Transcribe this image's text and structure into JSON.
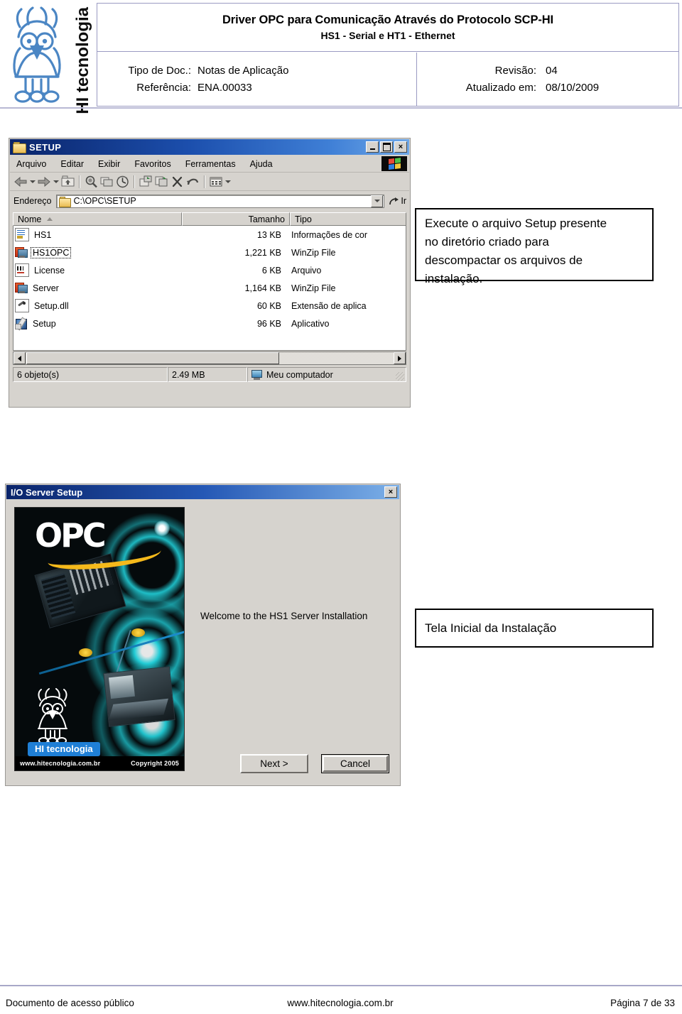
{
  "doc_header": {
    "logo_text": "HI tecnologia",
    "logo_icon": "owl-logo-icon",
    "title_line1": "Driver OPC para Comunicação Através do Protocolo SCP-HI",
    "title_line2": "HS1 - Serial e HT1 - Ethernet",
    "fields": {
      "doc_type_label": "Tipo de Doc.:",
      "doc_type_value": "Notas de Aplicação",
      "reference_label": "Referência:",
      "reference_value": "ENA.00033",
      "revision_label": "Revisão:",
      "revision_value": "04",
      "updated_label": "Atualizado em:",
      "updated_value": "08/10/2009"
    }
  },
  "explorer": {
    "title": "SETUP",
    "title_icon": "folder-icon",
    "window_buttons": {
      "minimize": "minimize-icon",
      "maximize": "maximize-icon",
      "close": "×"
    },
    "menu": [
      "Arquivo",
      "Editar",
      "Exibir",
      "Favoritos",
      "Ferramentas",
      "Ajuda"
    ],
    "brand_icon": "windows-flag-icon",
    "toolbar_icons": [
      "back-arrow-icon",
      "back-dropdown-icon",
      "forward-arrow-icon",
      "forward-dropdown-icon",
      "up-one-level-icon",
      "search-icon",
      "folders-icon",
      "history-icon",
      "move-to-icon",
      "copy-to-icon",
      "delete-icon",
      "undo-icon",
      "views-icon",
      "views-dropdown-icon"
    ],
    "address": {
      "label": "Endereço",
      "folder_icon": "folder-icon",
      "value": "C:\\OPC\\SETUP",
      "dropdown_icon": "chevron-down-icon",
      "go_icon": "go-arrow-icon",
      "go_label": "Ir"
    },
    "columns": [
      "Nome",
      "Tamanho",
      "Tipo"
    ],
    "sort_indicator": "sort-ascending-icon",
    "files": [
      {
        "name": "HS1",
        "size": "13 KB",
        "type": "Informações de cor",
        "icon": "inf-file-icon",
        "selected": false
      },
      {
        "name": "HS1OPC",
        "size": "1,221 KB",
        "type": "WinZip File",
        "icon": "winzip-file-icon",
        "selected": true
      },
      {
        "name": "License",
        "size": "6 KB",
        "type": "Arquivo",
        "icon": "generic-file-icon",
        "selected": false
      },
      {
        "name": "Server",
        "size": "1,164 KB",
        "type": "WinZip File",
        "icon": "winzip-file-icon",
        "selected": false
      },
      {
        "name": "Setup.dll",
        "size": "60 KB",
        "type": "Extensão de aplica",
        "icon": "dll-file-icon",
        "selected": false
      },
      {
        "name": "Setup",
        "size": "96 KB",
        "type": "Aplicativo",
        "icon": "application-icon",
        "selected": false
      }
    ],
    "status": {
      "objects": "6 objeto(s)",
      "total_size": "2.49 MB",
      "location": "Meu computador",
      "location_icon": "my-computer-icon"
    },
    "scrollbar": {
      "left_icon": "scroll-left-icon",
      "right_icon": "scroll-right-icon"
    }
  },
  "setup_dialog": {
    "title": "I/O Server Setup",
    "close_label": "×",
    "close_icon": "close-icon",
    "welcome_text": "Welcome to the HS1 Server Installation",
    "buttons": {
      "next": "Next >",
      "cancel": "Cancel"
    },
    "artwork": {
      "brand": "OPC",
      "badge": "HI tecnologia",
      "owl_icon": "owl-logo-icon",
      "site": "www.hitecnologia.com.br",
      "copyright": "Copyright 2005"
    }
  },
  "captions": {
    "caption_1_line1": "Execute o arquivo Setup presente",
    "caption_1_line2": "no diretório criado para",
    "caption_1_line3": "descompactar os arquivos de",
    "caption_1_line4": "instalação.",
    "caption_2": "Tela Inicial da Instalação"
  },
  "footer": {
    "left": "Documento de acesso público",
    "center": "www.hitecnologia.com.br",
    "right": "Página 7 de 33"
  },
  "colors": {
    "header_border": "#9a9ac2",
    "titlebar_blue": "#0a246a",
    "window_face": "#d6d3ce",
    "accent_orange": "#f5b91b",
    "accent_cyan": "#22d6e0"
  }
}
